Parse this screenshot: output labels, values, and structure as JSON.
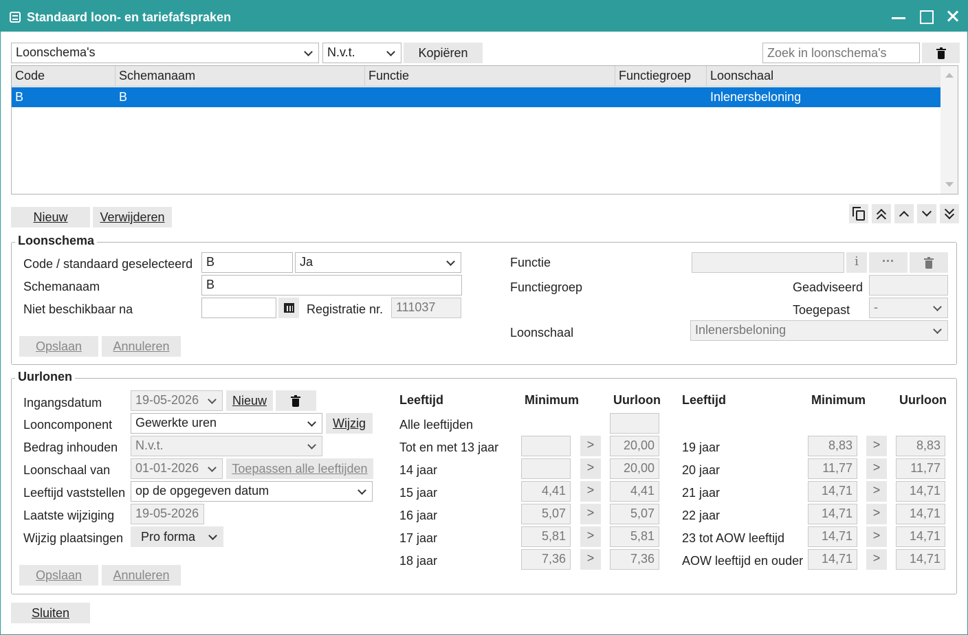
{
  "window": {
    "title": "Standaard loon- en tariefafspraken"
  },
  "toolbar": {
    "type_select": "Loonschema's",
    "nvt_select": "N.v.t.",
    "copy_button": "Kopiëren",
    "search_placeholder": "Zoek in loonschema's"
  },
  "grid": {
    "columns": [
      "Code",
      "Schemanaam",
      "Functie",
      "Functiegroep",
      "Loonschaal"
    ],
    "rows": [
      {
        "code": "B",
        "schemanaam": "B",
        "functie": "",
        "functiegroep": "",
        "loonschaal": "Inlenersbeloning"
      }
    ]
  },
  "actions": {
    "new_label": "Nieuw",
    "delete_label": "Verwijderen"
  },
  "loonschema": {
    "legend": "Loonschema",
    "code_label": "Code / standaard geselecteerd",
    "code_value": "B",
    "standard_value": "Ja",
    "name_label": "Schemanaam",
    "name_value": "B",
    "unavailable_label": "Niet beschikbaar na",
    "unavailable_value": "",
    "registration_label": "Registratie nr.",
    "registration_value": "111037",
    "save_label": "Opslaan",
    "cancel_label": "Annuleren",
    "function_label": "Functie",
    "function_value": "",
    "info_glyph": "i",
    "more_glyph": "···",
    "function_group_label": "Functiegroep",
    "advised_label": "Geadviseerd",
    "advised_value": "",
    "applied_label": "Toegepast",
    "applied_value": "-",
    "scale_label": "Loonschaal",
    "scale_value": "Inlenersbeloning"
  },
  "uurlonen": {
    "legend": "Uurlonen",
    "start_label": "Ingangsdatum",
    "start_value": "19-05-2026",
    "new_label": "Nieuw",
    "component_label": "Looncomponent",
    "component_value": "Gewerkte uren",
    "change_label": "Wijzig",
    "withhold_label": "Bedrag inhouden",
    "withhold_value": "N.v.t.",
    "scale_from_label": "Loonschaal van",
    "scale_from_value": "01-01-2026",
    "apply_all_label": "Toepassen alle leeftijden",
    "age_determine_label": "Leeftijd vaststellen",
    "age_determine_value": "op de opgegeven datum",
    "last_change_label": "Laatste wijziging",
    "last_change_value": "19-05-2026",
    "placements_label": "Wijzig plaatsingen",
    "placements_value": "Pro forma",
    "save_label": "Opslaan",
    "cancel_label": "Annuleren",
    "col_age": "Leeftijd",
    "col_min": "Minimum",
    "col_wage": "Uurloon",
    "transfer_glyph": ">",
    "all_ages_label": "Alle leeftijden",
    "all_ages_value": "",
    "left_rows": [
      {
        "age": "Tot en met 13 jaar",
        "min": "",
        "wage": "20,00"
      },
      {
        "age": "14 jaar",
        "min": "",
        "wage": "20,00"
      },
      {
        "age": "15 jaar",
        "min": "4,41",
        "wage": "4,41"
      },
      {
        "age": "16 jaar",
        "min": "5,07",
        "wage": "5,07"
      },
      {
        "age": "17 jaar",
        "min": "5,81",
        "wage": "5,81"
      },
      {
        "age": "18 jaar",
        "min": "7,36",
        "wage": "7,36"
      }
    ],
    "right_rows": [
      {
        "age": "19 jaar",
        "min": "8,83",
        "wage": "8,83"
      },
      {
        "age": "20 jaar",
        "min": "11,77",
        "wage": "11,77"
      },
      {
        "age": "21 jaar",
        "min": "14,71",
        "wage": "14,71"
      },
      {
        "age": "22 jaar",
        "min": "14,71",
        "wage": "14,71"
      },
      {
        "age": "23 tot AOW leeftijd",
        "min": "14,71",
        "wage": "14,71"
      },
      {
        "age": "AOW leeftijd en ouder",
        "min": "14,71",
        "wage": "14,71"
      }
    ]
  },
  "footer": {
    "close_label": "Sluiten"
  },
  "colors": {
    "titlebar": "#2f9c9c",
    "selection": "#0a78d7"
  }
}
